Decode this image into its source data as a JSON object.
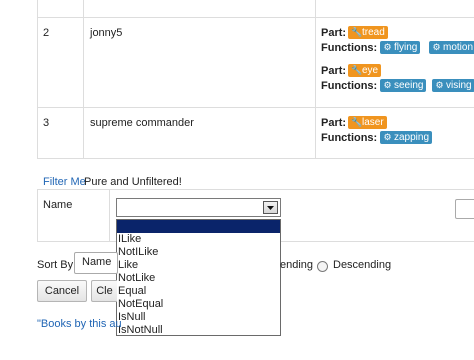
{
  "rows": [
    {
      "id": "2",
      "name": "jonny5",
      "parts": [
        {
          "label": "Part:",
          "part": "tread",
          "functions_label": "Functions:",
          "functions": [
            "flying",
            "motion"
          ]
        },
        {
          "label": "Part:",
          "part": "eye",
          "functions_label": "Functions:",
          "functions": [
            "seeing",
            "vising"
          ]
        }
      ]
    },
    {
      "id": "3",
      "name": "supreme commander",
      "parts": [
        {
          "label": "Part:",
          "part": "laser",
          "functions_label": "Functions:",
          "functions": [
            "zapping"
          ]
        }
      ]
    }
  ],
  "filter": {
    "link": "Filter Me",
    "status": "Pure and Unfiltered!",
    "name_label": "Name",
    "operator_selected": "",
    "operators": [
      "ILike",
      "NotILike",
      "Like",
      "NotLike",
      "Equal",
      "NotEqual",
      "IsNull",
      "IsNotNull"
    ]
  },
  "sort": {
    "label": "Sort By",
    "field": "Name",
    "ascending_fragment": "ending",
    "descending": "Descending"
  },
  "buttons": {
    "cancel": "Cancel",
    "clear_fragment": "Cle"
  },
  "footer": {
    "link_fragment": "\"Books by this au"
  },
  "icons": {
    "wrench": "wrench-icon",
    "gear": "gear-icon",
    "dropdown": "chevron-down-icon"
  },
  "colors": {
    "part_badge": "#f0951f",
    "function_badge": "#3a8fbd",
    "link": "#2166b5",
    "selection": "#0a246a"
  }
}
